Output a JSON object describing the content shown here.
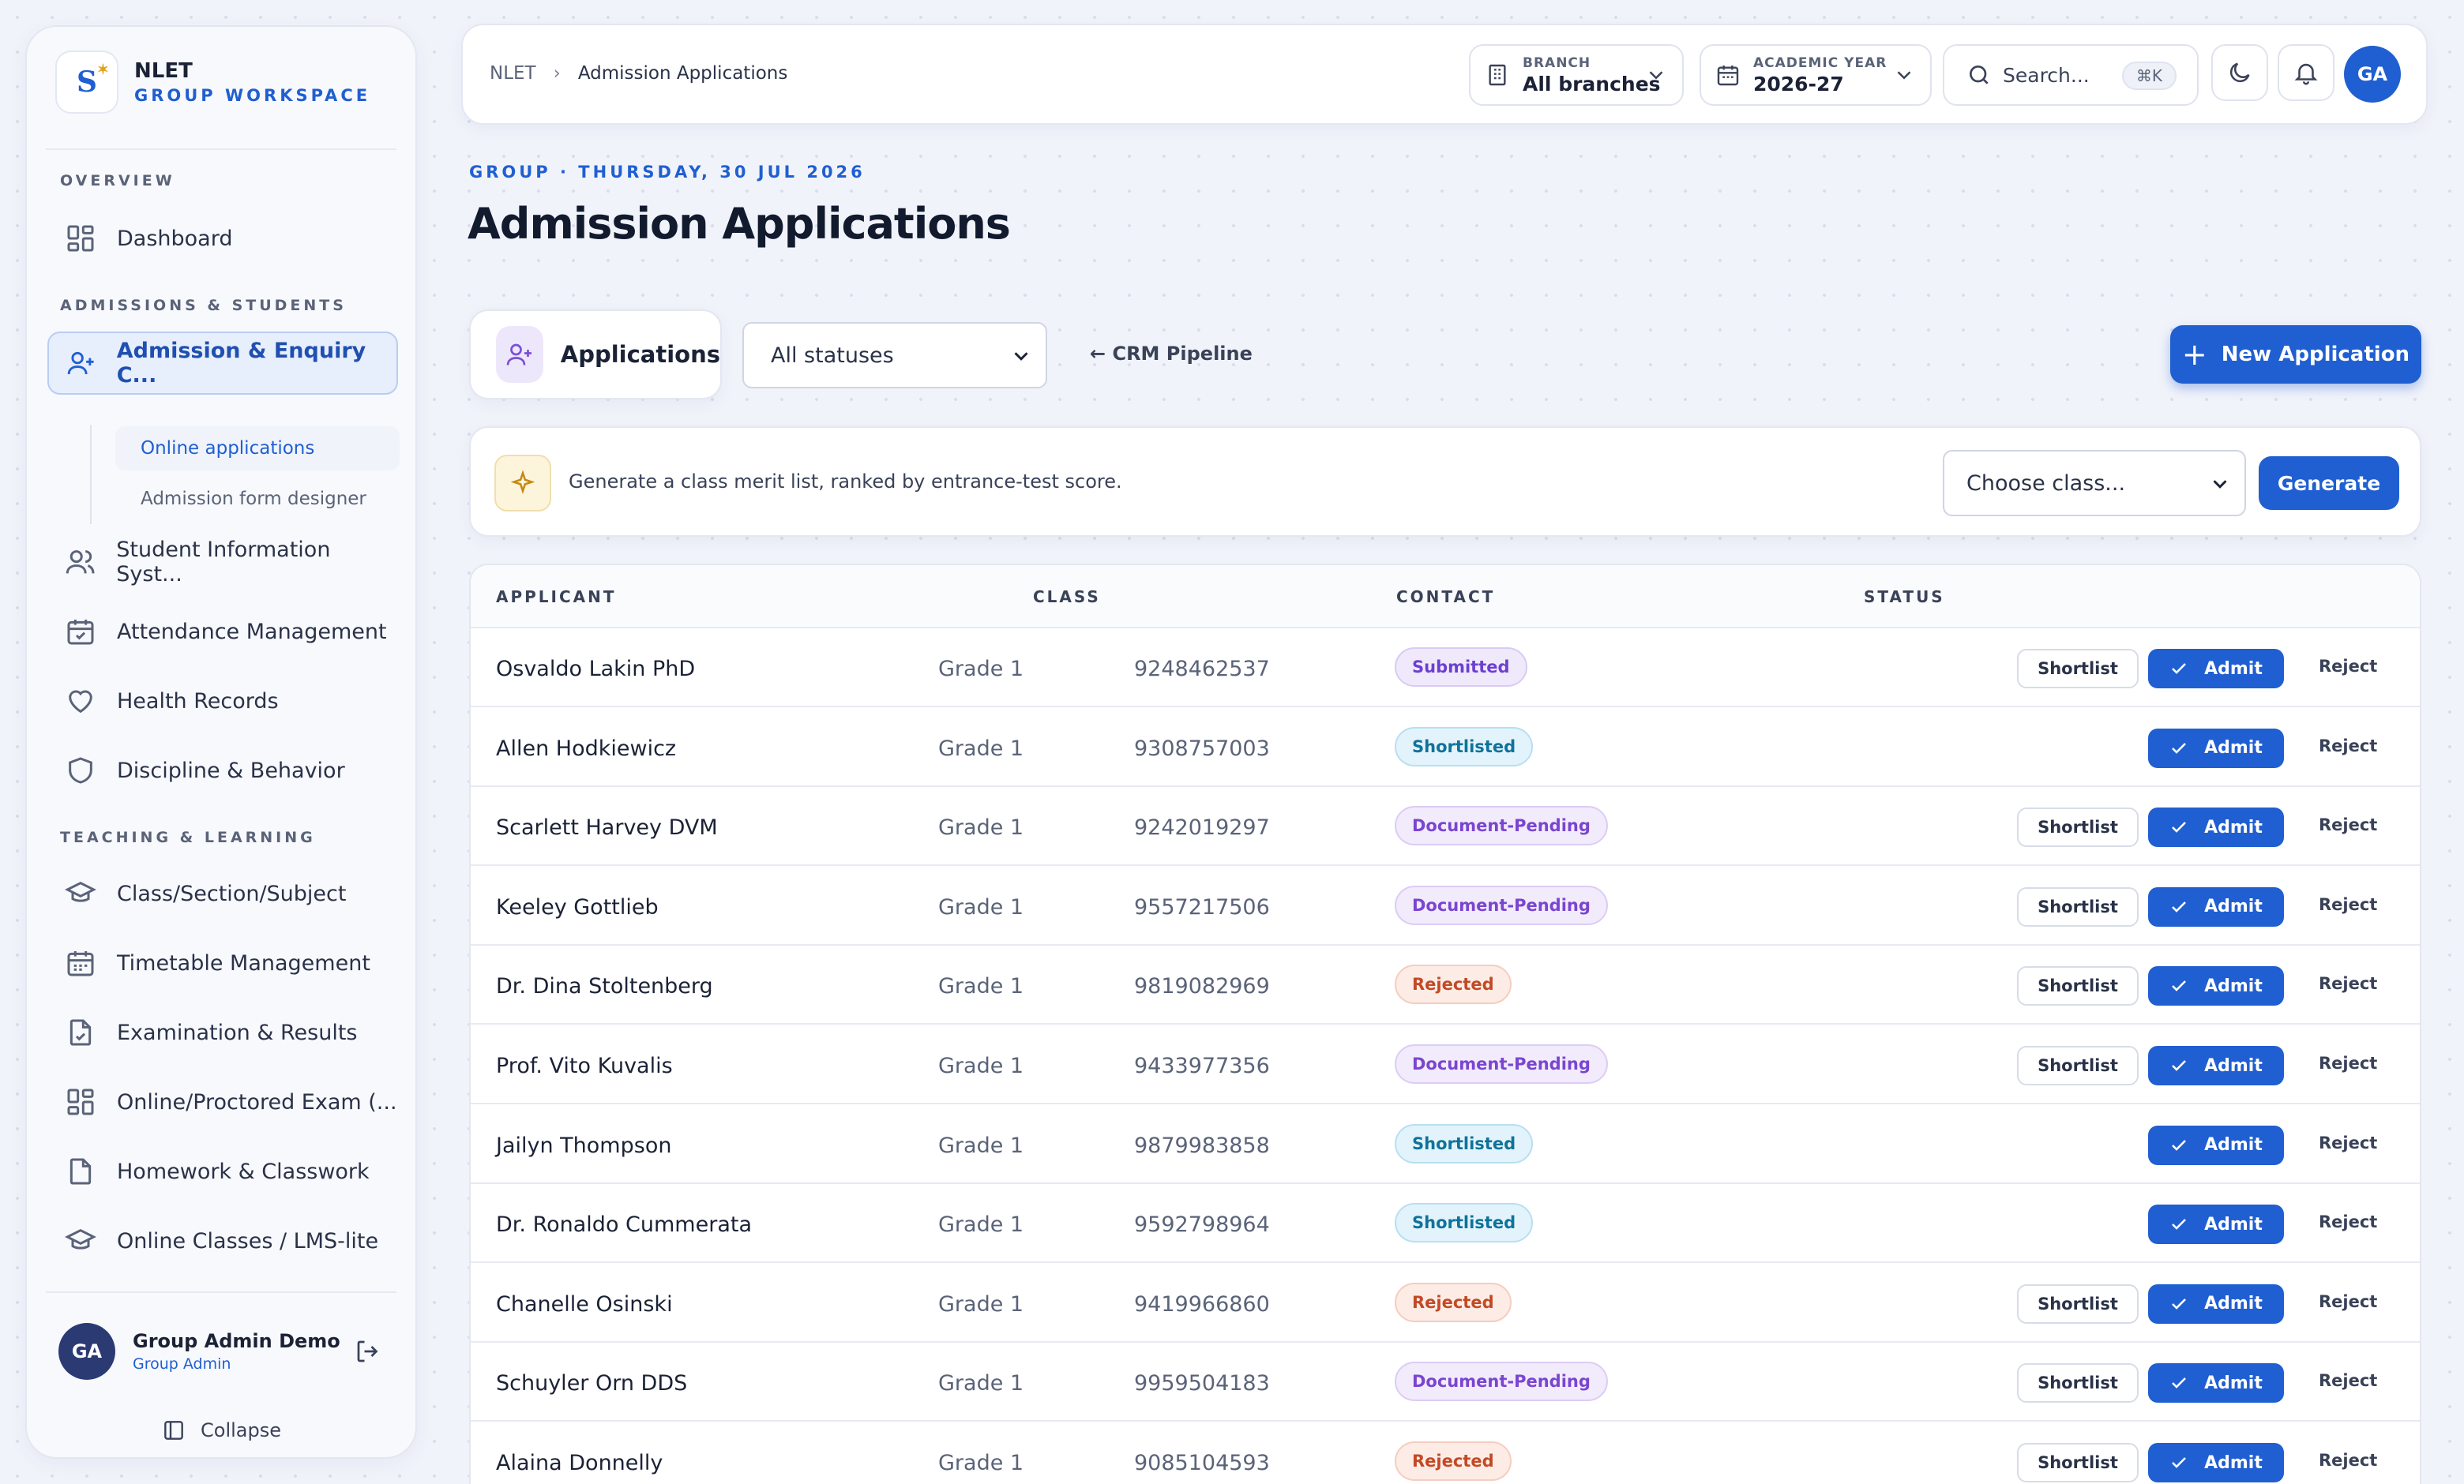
{
  "brand": {
    "logo": "S",
    "name": "NLET",
    "subtitle": "GROUP WORKSPACE"
  },
  "sidebar": {
    "sections": {
      "overview": "OVERVIEW",
      "admissions": "ADMISSIONS & STUDENTS",
      "teaching": "TEACHING & LEARNING"
    },
    "items": {
      "dashboard": "Dashboard",
      "admission": "Admission & Enquiry C...",
      "sis": "Student Information Syst...",
      "attendance": "Attendance Management",
      "health": "Health Records",
      "discipline": "Discipline & Behavior",
      "classes": "Class/Section/Subject",
      "timetable": "Timetable Management",
      "exams": "Examination & Results",
      "online_exam": "Online/Proctored Exam (...",
      "homework": "Homework & Classwork",
      "lms": "Online Classes / LMS-lite"
    },
    "sub_items": {
      "online_applications": "Online applications",
      "form_designer": "Admission form designer"
    },
    "user": {
      "initials": "GA",
      "name": "Group Admin Demo",
      "role": "Group Admin"
    },
    "collapse_label": "Collapse"
  },
  "topbar": {
    "breadcrumb_root": "NLET",
    "breadcrumb_sep": "›",
    "breadcrumb_current": "Admission Applications",
    "branch_label": "BRANCH",
    "branch_value": "All branches",
    "year_label": "ACADEMIC YEAR",
    "year_value": "2026-27",
    "search_placeholder": "Search...",
    "search_shortcut": "⌘K",
    "avatar_initials": "GA"
  },
  "page": {
    "eyebrow": "GROUP · THURSDAY, 30 JUL 2026",
    "title": "Admission Applications"
  },
  "toolbar": {
    "tab_label": "Applications",
    "status_filter": "All statuses",
    "crm_link": "← CRM Pipeline",
    "new_button": "New Application",
    "new_button_plus": "+"
  },
  "merit": {
    "text": "Generate a class merit list, ranked by entrance-test score.",
    "class_placeholder": "Choose class...",
    "generate_label": "Generate"
  },
  "table": {
    "headers": {
      "applicant": "APPLICANT",
      "class": "CLASS",
      "contact": "CONTACT",
      "status": "STATUS"
    },
    "actions": {
      "shortlist": "Shortlist",
      "admit": "Admit",
      "reject": "Reject"
    },
    "rows": [
      {
        "name": "Osvaldo Lakin PhD",
        "class": "Grade 1",
        "contact": "9248462537",
        "status": "Submitted",
        "kind": "sub",
        "shortlist": true
      },
      {
        "name": "Allen Hodkiewicz",
        "class": "Grade 1",
        "contact": "9308757003",
        "status": "Shortlisted",
        "kind": "short",
        "shortlist": false
      },
      {
        "name": "Scarlett Harvey DVM",
        "class": "Grade 1",
        "contact": "9242019297",
        "status": "Document-Pending",
        "kind": "doc",
        "shortlist": true
      },
      {
        "name": "Keeley Gottlieb",
        "class": "Grade 1",
        "contact": "9557217506",
        "status": "Document-Pending",
        "kind": "doc",
        "shortlist": true
      },
      {
        "name": "Dr. Dina Stoltenberg",
        "class": "Grade 1",
        "contact": "9819082969",
        "status": "Rejected",
        "kind": "rej",
        "shortlist": true
      },
      {
        "name": "Prof. Vito Kuvalis",
        "class": "Grade 1",
        "contact": "9433977356",
        "status": "Document-Pending",
        "kind": "doc",
        "shortlist": true
      },
      {
        "name": "Jailyn Thompson",
        "class": "Grade 1",
        "contact": "9879983858",
        "status": "Shortlisted",
        "kind": "short",
        "shortlist": false
      },
      {
        "name": "Dr. Ronaldo Cummerata",
        "class": "Grade 1",
        "contact": "9592798964",
        "status": "Shortlisted",
        "kind": "short",
        "shortlist": false
      },
      {
        "name": "Chanelle Osinski",
        "class": "Grade 1",
        "contact": "9419966860",
        "status": "Rejected",
        "kind": "rej",
        "shortlist": true
      },
      {
        "name": "Schuyler Orn DDS",
        "class": "Grade 1",
        "contact": "9959504183",
        "status": "Document-Pending",
        "kind": "doc",
        "shortlist": true
      },
      {
        "name": "Alaina Donnelly",
        "class": "Grade 1",
        "contact": "9085104593",
        "status": "Rejected",
        "kind": "rej",
        "shortlist": true
      }
    ]
  },
  "colors": {
    "accent": "#1f5fd1",
    "sidebar_active_bg": "#e7eefc"
  },
  "icons": {
    "dashboard": "grid-icon",
    "admission": "user-plus-icon",
    "sis": "users-icon",
    "attendance": "calendar-check-icon",
    "health": "heart-icon",
    "discipline": "shield-icon",
    "classes": "graduation-cap-icon",
    "timetable": "calendar-icon",
    "exams": "file-check-icon",
    "online_exam": "grid-icon",
    "homework": "file-icon",
    "lms": "graduation-cap-icon"
  }
}
